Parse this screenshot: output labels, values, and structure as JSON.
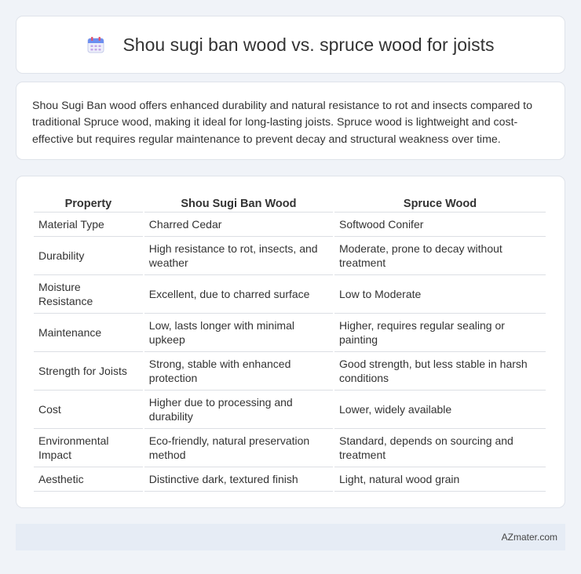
{
  "header": {
    "title": "Shou sugi ban wood vs. spruce wood for joists",
    "icon": "calendar-icon"
  },
  "intro": {
    "text": "Shou Sugi Ban wood offers enhanced durability and natural resistance to rot and insects compared to traditional Spruce wood, making it ideal for long-lasting joists. Spruce wood is lightweight and cost-effective but requires regular maintenance to prevent decay and structural weakness over time."
  },
  "table": {
    "headers": [
      "Property",
      "Shou Sugi Ban Wood",
      "Spruce Wood"
    ],
    "rows": [
      [
        "Material Type",
        "Charred Cedar",
        "Softwood Conifer"
      ],
      [
        "Durability",
        "High resistance to rot, insects, and weather",
        "Moderate, prone to decay without treatment"
      ],
      [
        "Moisture Resistance",
        "Excellent, due to charred surface",
        "Low to Moderate"
      ],
      [
        "Maintenance",
        "Low, lasts longer with minimal upkeep",
        "Higher, requires regular sealing or painting"
      ],
      [
        "Strength for Joists",
        "Strong, stable with enhanced protection",
        "Good strength, but less stable in harsh conditions"
      ],
      [
        "Cost",
        "Higher due to processing and durability",
        "Lower, widely available"
      ],
      [
        "Environmental Impact",
        "Eco-friendly, natural preservation method",
        "Standard, depends on sourcing and treatment"
      ],
      [
        "Aesthetic",
        "Distinctive dark, textured finish",
        "Light, natural wood grain"
      ]
    ]
  },
  "footer": {
    "site": "AZmater.com"
  }
}
